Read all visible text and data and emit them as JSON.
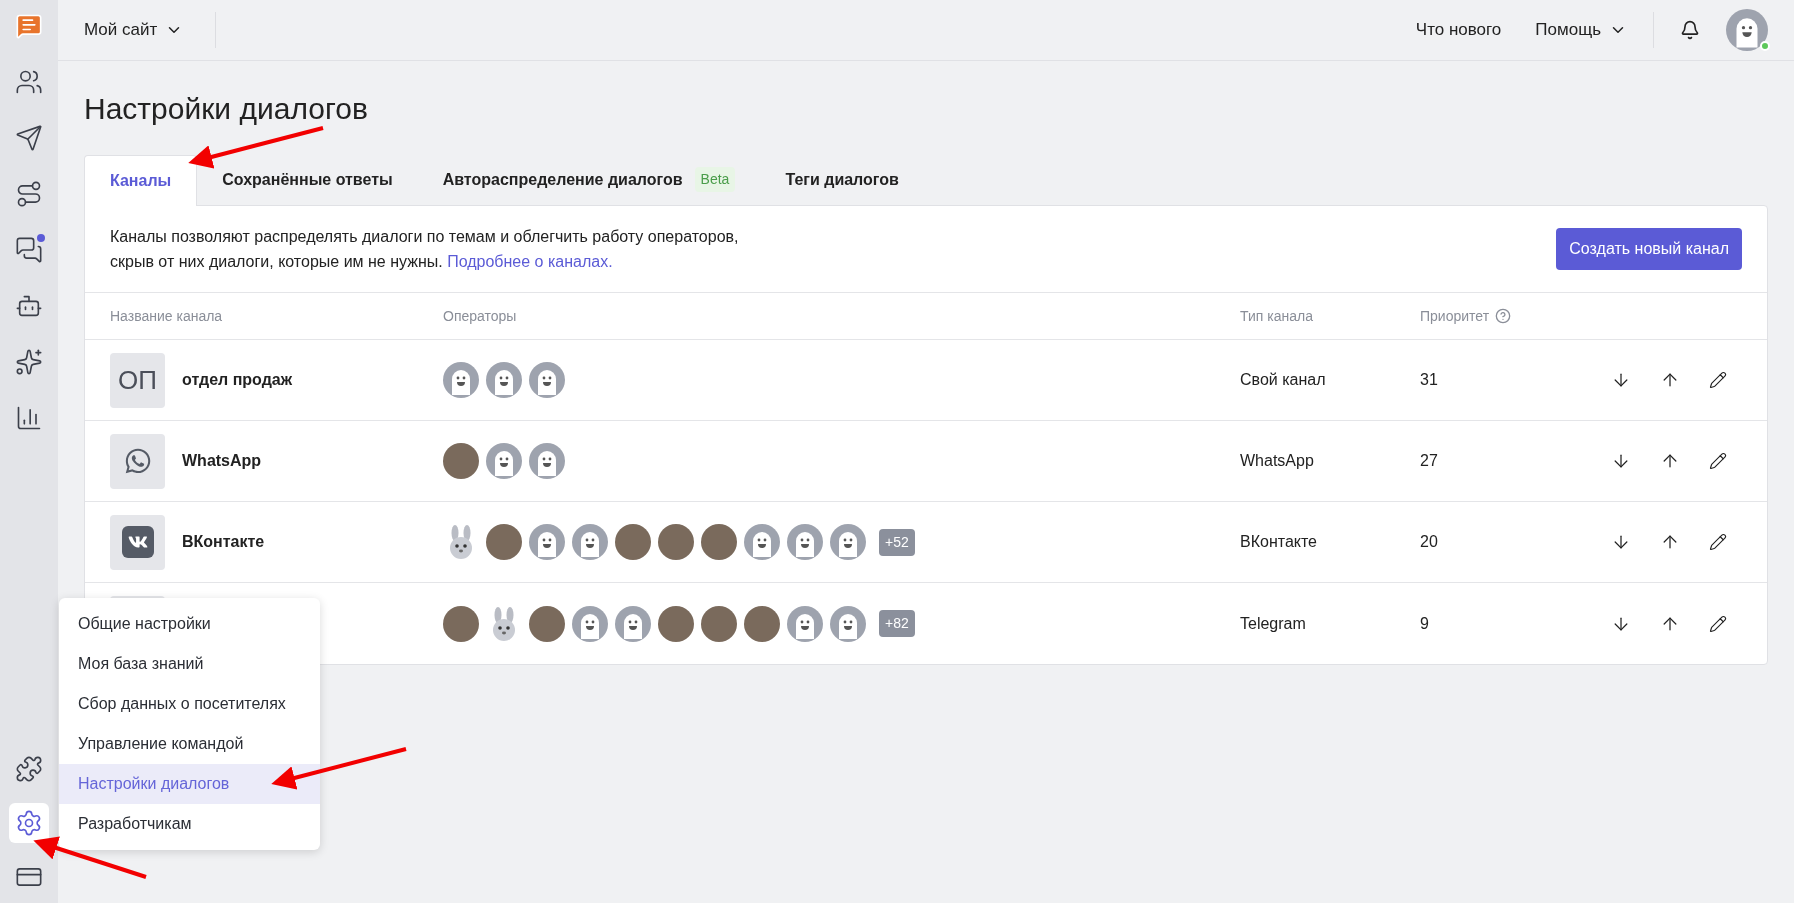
{
  "sidebar": {
    "items": [
      {
        "kind": "logo",
        "selected": false,
        "dot": false
      },
      {
        "kind": "users",
        "selected": false,
        "dot": false
      },
      {
        "kind": "send",
        "selected": false,
        "dot": false
      },
      {
        "kind": "route",
        "selected": false,
        "dot": false
      },
      {
        "kind": "chats",
        "selected": false,
        "dot": true
      },
      {
        "kind": "bot",
        "selected": false,
        "dot": false
      },
      {
        "kind": "sparkle-chat",
        "selected": false,
        "dot": false
      },
      {
        "kind": "reports",
        "selected": false,
        "dot": false
      }
    ],
    "bottom_items": [
      {
        "kind": "puzzle",
        "selected": false,
        "dot": false
      },
      {
        "kind": "settings",
        "selected": true,
        "dot": false
      },
      {
        "kind": "billing",
        "selected": false,
        "dot": false
      }
    ]
  },
  "topbar": {
    "site": "Мой сайт",
    "whats_new": "Что нового",
    "help": "Помощь",
    "online": true
  },
  "page": {
    "title": "Настройки диалогов"
  },
  "tabs": [
    {
      "label": "Каналы",
      "selected": true
    },
    {
      "label": "Сохранённые ответы",
      "selected": false
    },
    {
      "label": "Автораспределение диалогов",
      "selected": false,
      "badge": "Beta"
    },
    {
      "label": "Теги диалогов",
      "selected": false
    }
  ],
  "intro": {
    "text": "Каналы позволяют распределять диалоги по темам и облегчить работу операторов, скрыв от них диалоги, которые им не нужны.",
    "link": "Подробнее о каналах.",
    "button": "Создать новый канал"
  },
  "table": {
    "columns": [
      "Название канала",
      "Операторы",
      "Тип канала",
      "Приоритет"
    ],
    "rows": [
      {
        "icon": {
          "kind": "initials",
          "text": "ОП"
        },
        "name": "отдел продаж",
        "operators": [
          {
            "kind": "default"
          },
          {
            "kind": "default"
          },
          {
            "kind": "default"
          }
        ],
        "type": "Свой канал",
        "priority": "31"
      },
      {
        "icon": {
          "kind": "whatsapp"
        },
        "name": "WhatsApp",
        "operators": [
          {
            "kind": "photo"
          },
          {
            "kind": "default"
          },
          {
            "kind": "default"
          }
        ],
        "type": "WhatsApp",
        "priority": "27"
      },
      {
        "icon": {
          "kind": "vk"
        },
        "name": "ВКонтакте",
        "operators": [
          {
            "kind": "bunny"
          },
          {
            "kind": "photo"
          },
          {
            "kind": "default"
          },
          {
            "kind": "default"
          },
          {
            "kind": "photo"
          },
          {
            "kind": "photo"
          },
          {
            "kind": "photo"
          },
          {
            "kind": "default"
          },
          {
            "kind": "default"
          },
          {
            "kind": "default"
          }
        ],
        "more": "+52",
        "type": "ВКонтакте",
        "priority": "20"
      },
      {
        "icon": {
          "kind": "blank"
        },
        "operators": [
          {
            "kind": "photo"
          },
          {
            "kind": "bunny"
          },
          {
            "kind": "photo"
          },
          {
            "kind": "default"
          },
          {
            "kind": "default"
          },
          {
            "kind": "photo"
          },
          {
            "kind": "photo"
          },
          {
            "kind": "photo"
          },
          {
            "kind": "default"
          },
          {
            "kind": "default"
          }
        ],
        "more": "+82",
        "type": "Telegram",
        "priority": "9"
      }
    ]
  },
  "menu": {
    "items": [
      {
        "label": "Общие настройки",
        "selected": false
      },
      {
        "label": "Моя база знаний",
        "selected": false
      },
      {
        "label": "Сбор данных о посетителях",
        "selected": false
      },
      {
        "label": "Управление командой",
        "selected": false
      },
      {
        "label": "Настройки диалогов",
        "selected": true
      },
      {
        "label": "Разработчикам",
        "selected": false
      }
    ]
  }
}
